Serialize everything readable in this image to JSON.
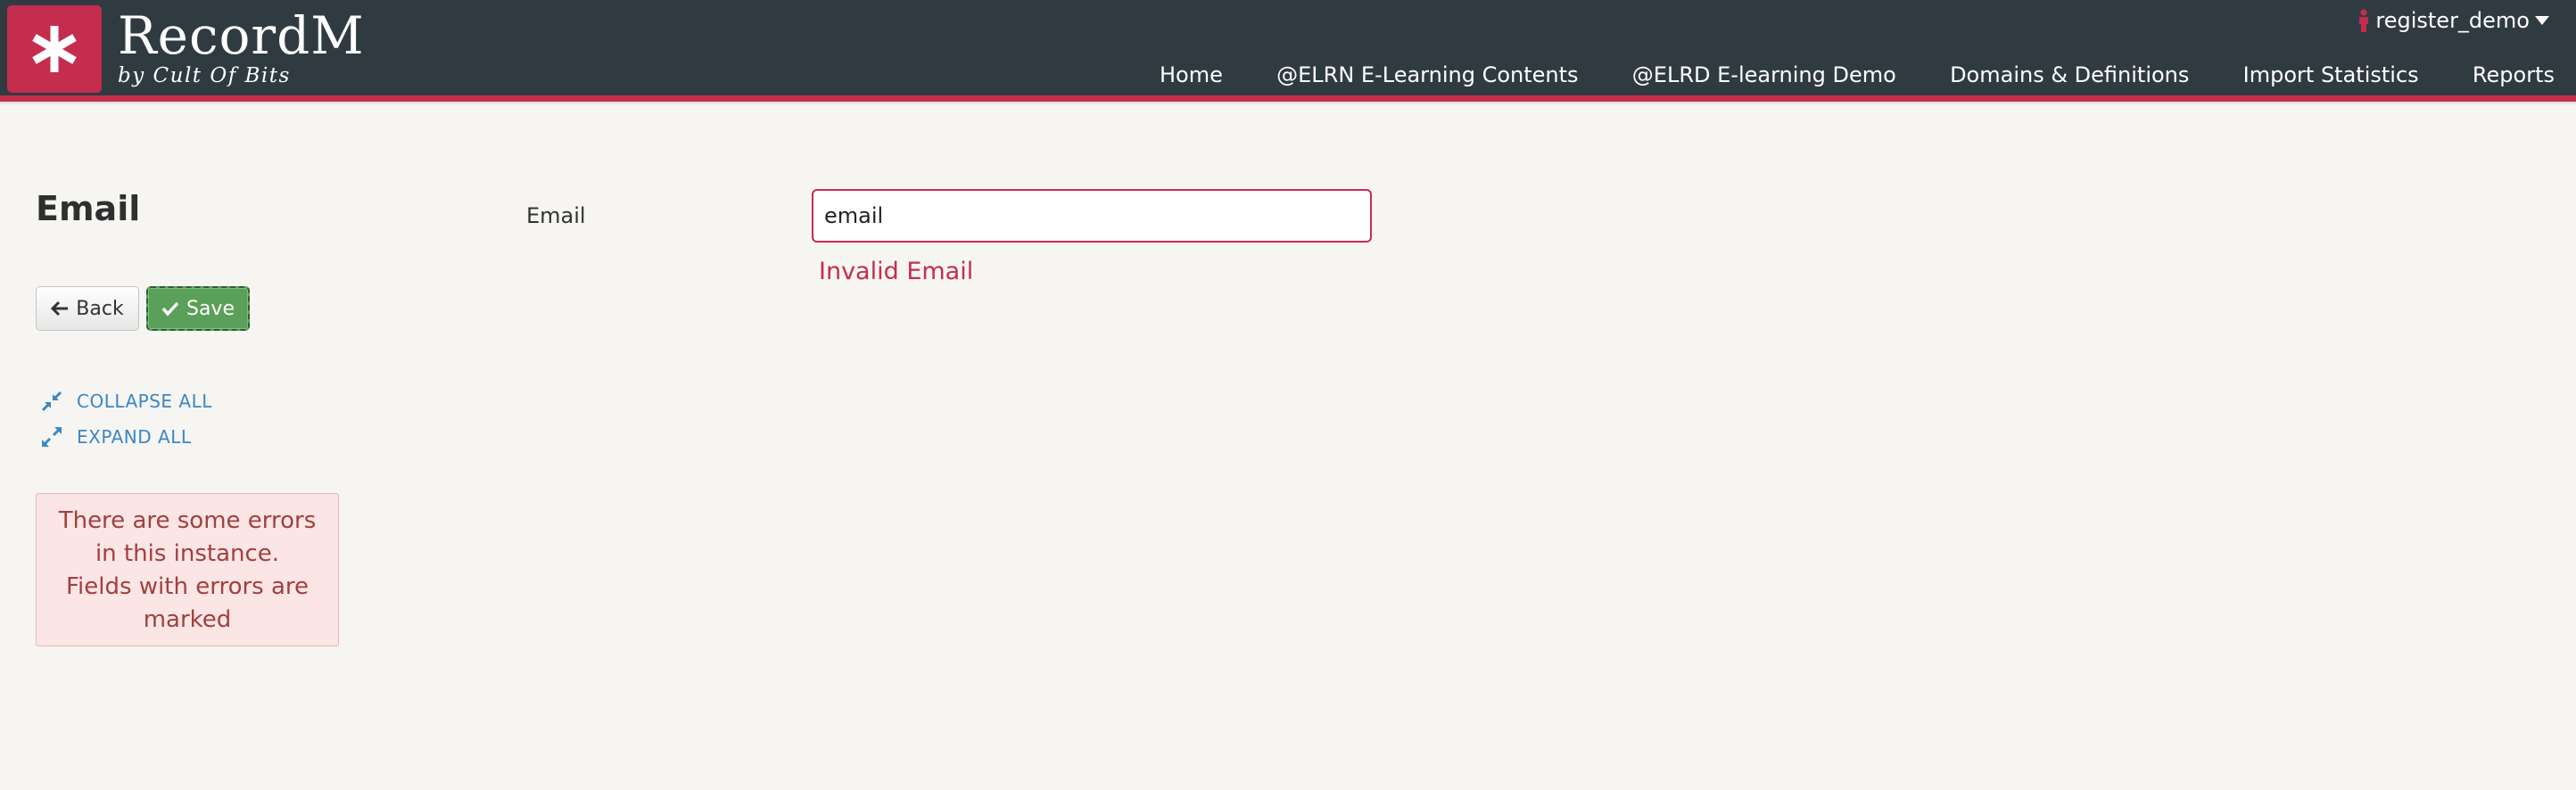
{
  "brand": {
    "title": "RecordM",
    "subtitle": "by Cult Of Bits",
    "logo_icon": "asterisk-icon",
    "color": "#c42d4e"
  },
  "header": {
    "user": {
      "icon": "person-icon",
      "name": "register_demo",
      "dropdown_icon": "caret-down-icon"
    },
    "nav": [
      {
        "label": "Home"
      },
      {
        "label": "@ELRN E-Learning Contents"
      },
      {
        "label": "@ELRD E-learning Demo"
      },
      {
        "label": "Domains & Definitions"
      },
      {
        "label": "Import Statistics"
      },
      {
        "label": "Reports"
      }
    ]
  },
  "page": {
    "title": "Email"
  },
  "actions": {
    "back_label": "Back",
    "back_icon": "arrow-left-icon",
    "save_label": "Save",
    "save_icon": "check-icon"
  },
  "links": {
    "collapse_all": "COLLAPSE ALL",
    "expand_all": "EXPAND ALL"
  },
  "error_box": {
    "line1": "There are some errors in this instance.",
    "line2": "Fields with errors are marked"
  },
  "form": {
    "email": {
      "label": "Email",
      "value": "email",
      "error": "Invalid Email"
    }
  },
  "colors": {
    "header_bg": "#303b41",
    "accent": "#c42d4e",
    "save_green": "#5aa05a",
    "link_blue": "#3a87c7",
    "error_text": "#a0403f",
    "error_bg": "#fbe5e5"
  }
}
